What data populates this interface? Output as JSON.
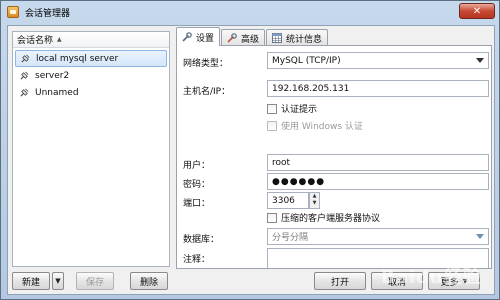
{
  "window": {
    "title": "会话管理器",
    "close_label": "✕"
  },
  "sessions": {
    "header": "会话名称",
    "items": [
      {
        "label": "local mysql server",
        "selected": true
      },
      {
        "label": "server2",
        "selected": false
      },
      {
        "label": "Unnamed",
        "selected": false
      }
    ]
  },
  "left_buttons": {
    "new_label": "新建",
    "save_label": "保存",
    "delete_label": "删除"
  },
  "tabs": [
    {
      "label": "设置",
      "icon": "wrench-icon",
      "active": true
    },
    {
      "label": "高级",
      "icon": "wrench-icon",
      "active": false
    },
    {
      "label": "统计信息",
      "icon": "table-icon",
      "active": false
    }
  ],
  "settings": {
    "network_type_label": "网络类型：",
    "network_type_value": "MySQL (TCP/IP)",
    "host_label": "主机名/IP：",
    "host_value": "192.168.205.131",
    "auth_prompt_label": "认证提示",
    "windows_auth_label": "使用 Windows 认证",
    "user_label": "用户：",
    "user_value": "root",
    "password_label": "密码：",
    "password_value": "●●●●●●",
    "port_label": "端口：",
    "port_value": "3306",
    "compress_label": "压缩的客户端服务器协议",
    "database_label": "数据库：",
    "database_placeholder": "分号分隔",
    "notes_label": "注释："
  },
  "bottom_buttons": {
    "open_label": "打开",
    "cancel_label": "取消",
    "more_label": "更多"
  },
  "watermark": "Baidu经验"
}
